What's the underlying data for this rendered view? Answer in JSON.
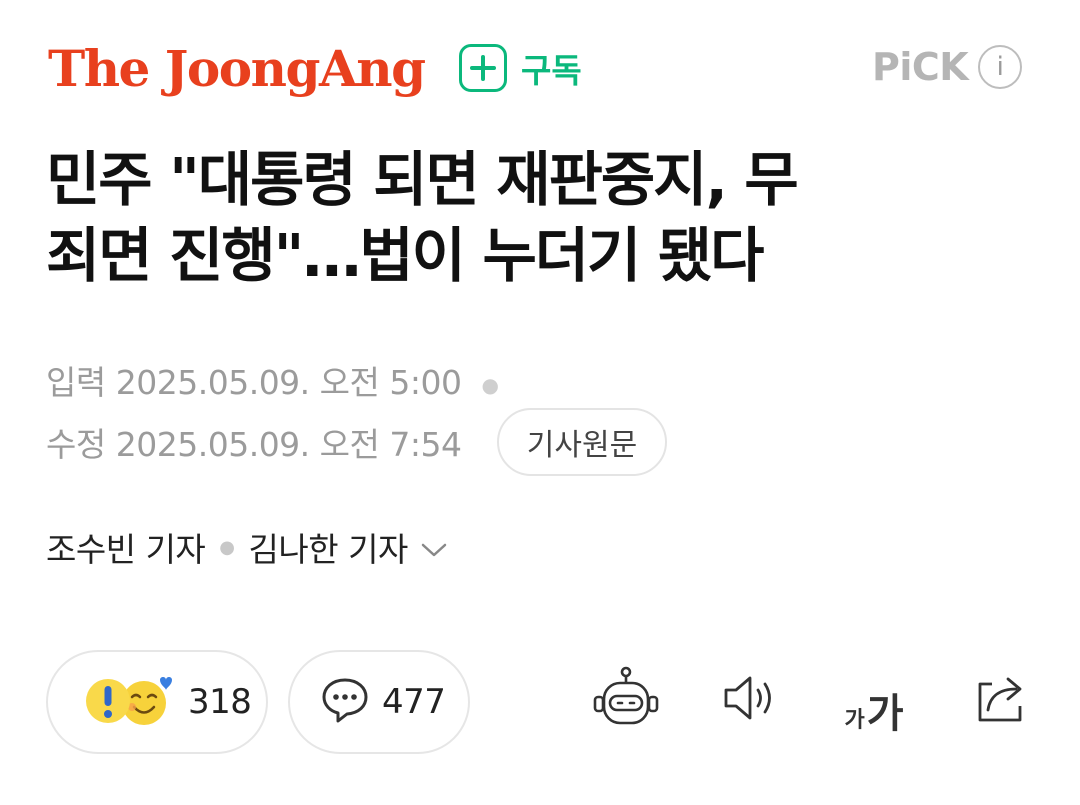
{
  "header": {
    "brand": "The JoongAng",
    "subscribe_label": "구독",
    "pick_label": "PiCK",
    "info_label": "i"
  },
  "article": {
    "headline_line1": "민주 \"대통령 되면 재판중지, 무",
    "headline_line2": "죄면 진행\"…법이 누더기 됐다",
    "input_label": "입력",
    "input_time": "2025.05.09. 오전 5:00",
    "modified_label": "수정",
    "modified_time": "2025.05.09. 오전 7:54",
    "original_button": "기사원문",
    "reporters": [
      "조수빈 기자",
      "김나한 기자"
    ]
  },
  "actions": {
    "reaction_count": "318",
    "comment_count": "477",
    "font_small": "가",
    "font_big": "가"
  },
  "icons": {
    "subscribe": "plus-square-icon",
    "info": "info-circle-icon",
    "reporters_expand": "chevron-down-icon",
    "reaction": "reaction-emoji-icon",
    "comment": "speech-bubble-icon",
    "summary_bot": "robot-icon",
    "read_aloud": "speaker-icon",
    "font_size": "font-size-icon",
    "share": "share-icon"
  },
  "colors": {
    "brand": "#e8401e",
    "subscribe": "#0bb87c",
    "meta_text": "#9b9b9b",
    "pick": "#b5b5b5"
  }
}
